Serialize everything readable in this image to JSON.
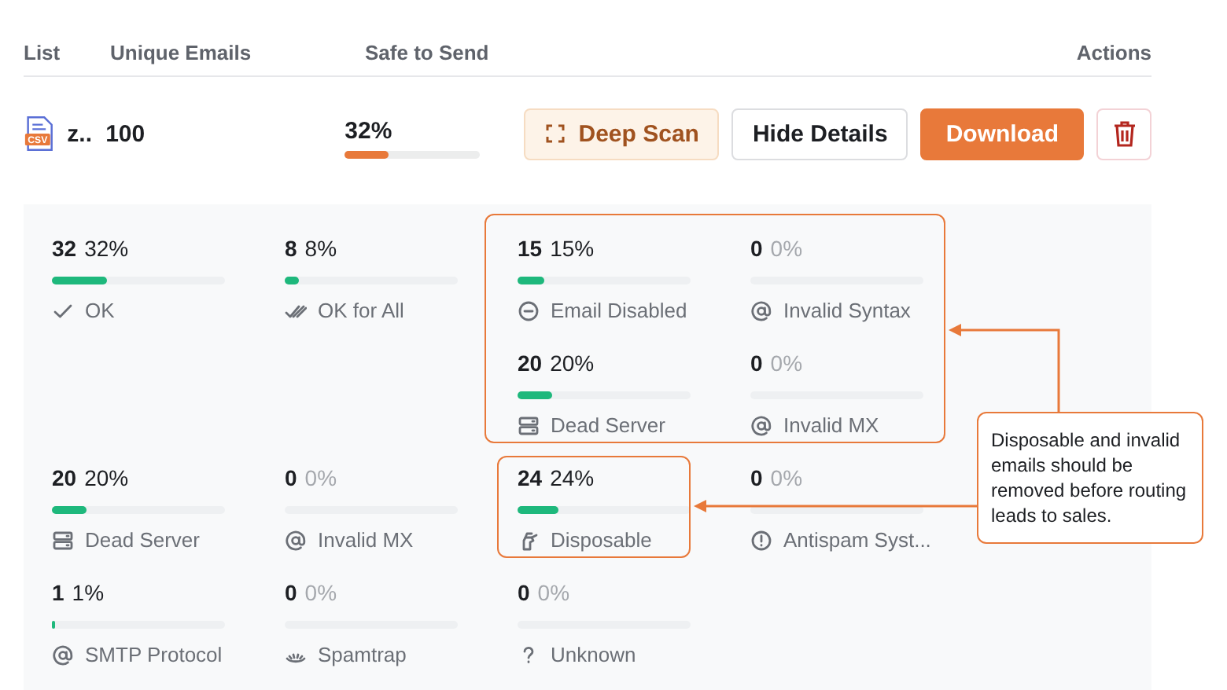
{
  "table": {
    "columns": [
      "List",
      "Unique Emails",
      "Safe to Send",
      "Actions"
    ],
    "row": {
      "file_badge": "CSV",
      "name": "z..",
      "unique_emails": "100",
      "safe_percent": "32%",
      "level": 0.32,
      "buttons": [
        {
          "kind": "scan",
          "label": "Deep Scan"
        },
        {
          "kind": "plain",
          "label": "Hide Details"
        },
        {
          "kind": "primary",
          "label": "Download"
        },
        {
          "kind": "delete"
        }
      ]
    }
  },
  "details": {
    "rows": [
      [
        {
          "kind": "ok",
          "count": "32",
          "percent": "32%",
          "level": 0.32,
          "label": "OK"
        },
        {
          "kind": "ok_all",
          "count": "8",
          "percent": "8%",
          "level": 0.08,
          "label": "OK for All"
        },
        {
          "kind": "disabled",
          "count": "15",
          "percent": "15%",
          "level": 0.15,
          "label": "Email Disabled"
        },
        {
          "kind": "at",
          "count": "0",
          "percent": "0%",
          "label": "Invalid Syntax"
        }
      ],
      [
        {
          "kind": "empty"
        },
        {
          "kind": "empty"
        },
        {
          "kind": "server",
          "count": "20",
          "percent": "20%",
          "level": 0.2,
          "label": "Dead Server"
        },
        {
          "kind": "at",
          "count": "0",
          "percent": "0%",
          "label": "Invalid MX"
        }
      ],
      [
        {
          "kind": "server",
          "count": "20",
          "percent": "20%",
          "level": 0.2,
          "label": "Dead Server"
        },
        {
          "kind": "at",
          "count": "0",
          "percent": "0%",
          "label": "Invalid MX"
        },
        {
          "kind": "disposable",
          "count": "24",
          "percent": "24%",
          "level": 0.24,
          "label": "Disposable"
        },
        {
          "kind": "alert",
          "count": "0",
          "percent": "0%",
          "label": "Antispam Syst..."
        }
      ],
      [
        {
          "kind": "at",
          "count": "1",
          "percent": "1%",
          "level": 0.01,
          "label": "SMTP Protocol"
        },
        {
          "kind": "spamtrap",
          "count": "0",
          "percent": "0%",
          "label": "Spamtrap"
        },
        {
          "kind": "unknown",
          "count": "0",
          "percent": "0%",
          "label": "Unknown"
        },
        {
          "kind": "empty"
        }
      ]
    ]
  },
  "callout": {
    "text": "Disposable and invalid emails should be removed before routing leads to sales."
  }
}
